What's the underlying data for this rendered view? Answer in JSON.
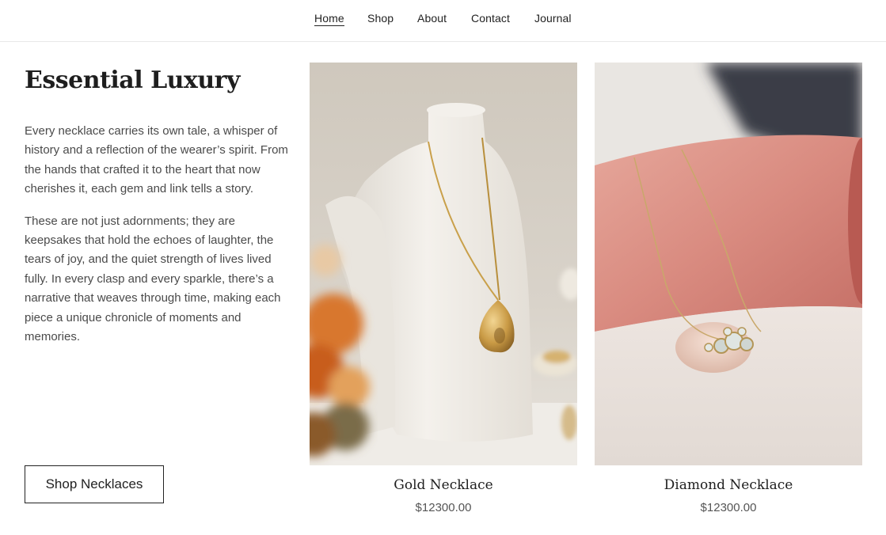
{
  "nav": {
    "items": [
      {
        "label": "Home",
        "active": true
      },
      {
        "label": "Shop"
      },
      {
        "label": "About"
      },
      {
        "label": "Contact"
      },
      {
        "label": "Journal"
      }
    ]
  },
  "intro": {
    "title": "Essential Luxury",
    "paragraph1": "Every necklace carries its own tale, a whisper of history and a reflection of the wearer’s spirit. From the hands that crafted it to the heart that now cherishes it, each gem and link tells a story.",
    "paragraph2": "These are not just adornments; they are keepsakes that hold the echoes of laughter, the tears of joy, and the quiet strength of lives lived fully. In every clasp and every sparkle, there’s a narrative that weaves through time, making each piece a unique chronicle of moments and memories.",
    "cta_label": "Shop Necklaces"
  },
  "products": [
    {
      "name": "Gold Necklace",
      "price": "$12300.00"
    },
    {
      "name": "Diamond Necklace",
      "price": "$12300.00"
    }
  ]
}
